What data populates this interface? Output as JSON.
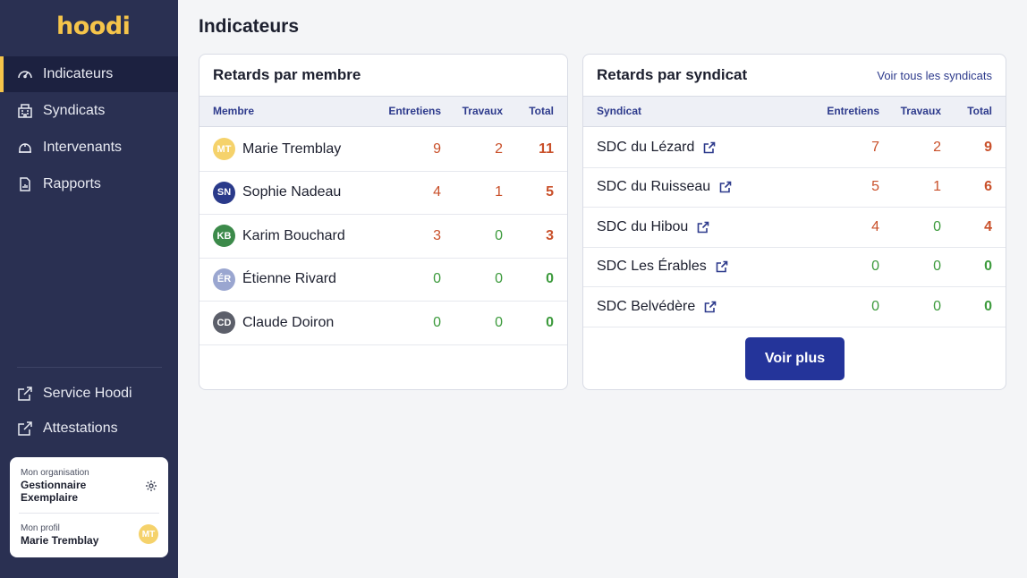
{
  "app": {
    "logo_text": "hoodi",
    "brand_color": "#f5c44a",
    "sidebar_color": "#2a3052"
  },
  "sidebar": {
    "items": [
      {
        "label": "Indicateurs",
        "icon": "gauge-icon",
        "active": true
      },
      {
        "label": "Syndicats",
        "icon": "building-icon",
        "active": false
      },
      {
        "label": "Intervenants",
        "icon": "worker-icon",
        "active": false
      },
      {
        "label": "Rapports",
        "icon": "report-icon",
        "active": false
      }
    ],
    "external_links": [
      {
        "label": "Service Hoodi",
        "icon": "external-link-icon"
      },
      {
        "label": "Attestations",
        "icon": "external-link-icon"
      }
    ],
    "org_card": {
      "org_caption": "Mon organisation",
      "org_name": "Gestionnaire Exemplaire",
      "profile_caption": "Mon profil",
      "profile_name": "Marie Tremblay",
      "profile_initials": "MT"
    }
  },
  "main": {
    "title": "Indicateurs",
    "members_card": {
      "title": "Retards par membre",
      "columns": [
        "Membre",
        "Entretiens",
        "Travaux",
        "Total"
      ],
      "rows": [
        {
          "initials": "MT",
          "name": "Marie Tremblay",
          "avatar_color": "#f5d26b",
          "entretiens": "9",
          "travaux": "2",
          "total": "11"
        },
        {
          "initials": "SN",
          "name": "Sophie Nadeau",
          "avatar_color": "#2a3a8a",
          "entretiens": "4",
          "travaux": "1",
          "total": "5"
        },
        {
          "initials": "KB",
          "name": "Karim Bouchard",
          "avatar_color": "#3c8a4a",
          "entretiens": "3",
          "travaux": "0",
          "total": "3"
        },
        {
          "initials": "ÉR",
          "name": "Étienne Rivard",
          "avatar_color": "#9aa6d0",
          "entretiens": "0",
          "travaux": "0",
          "total": "0"
        },
        {
          "initials": "CD",
          "name": "Claude Doiron",
          "avatar_color": "#5c5f6a",
          "entretiens": "0",
          "travaux": "0",
          "total": "0"
        }
      ]
    },
    "syndicats_card": {
      "title": "Retards par syndicat",
      "link": "Voir tous les syndicats",
      "columns": [
        "Syndicat",
        "Entretiens",
        "Travaux",
        "Total"
      ],
      "rows": [
        {
          "name": "SDC du Lézard",
          "entretiens": "7",
          "travaux": "2",
          "total": "9"
        },
        {
          "name": "SDC du Ruisseau",
          "entretiens": "5",
          "travaux": "1",
          "total": "6"
        },
        {
          "name": "SDC du Hibou",
          "entretiens": "4",
          "travaux": "0",
          "total": "4"
        },
        {
          "name": "SDC Les Érables",
          "entretiens": "0",
          "travaux": "0",
          "total": "0"
        },
        {
          "name": "SDC Belvédère",
          "entretiens": "0",
          "travaux": "0",
          "total": "0"
        }
      ],
      "button": "Voir plus"
    }
  }
}
